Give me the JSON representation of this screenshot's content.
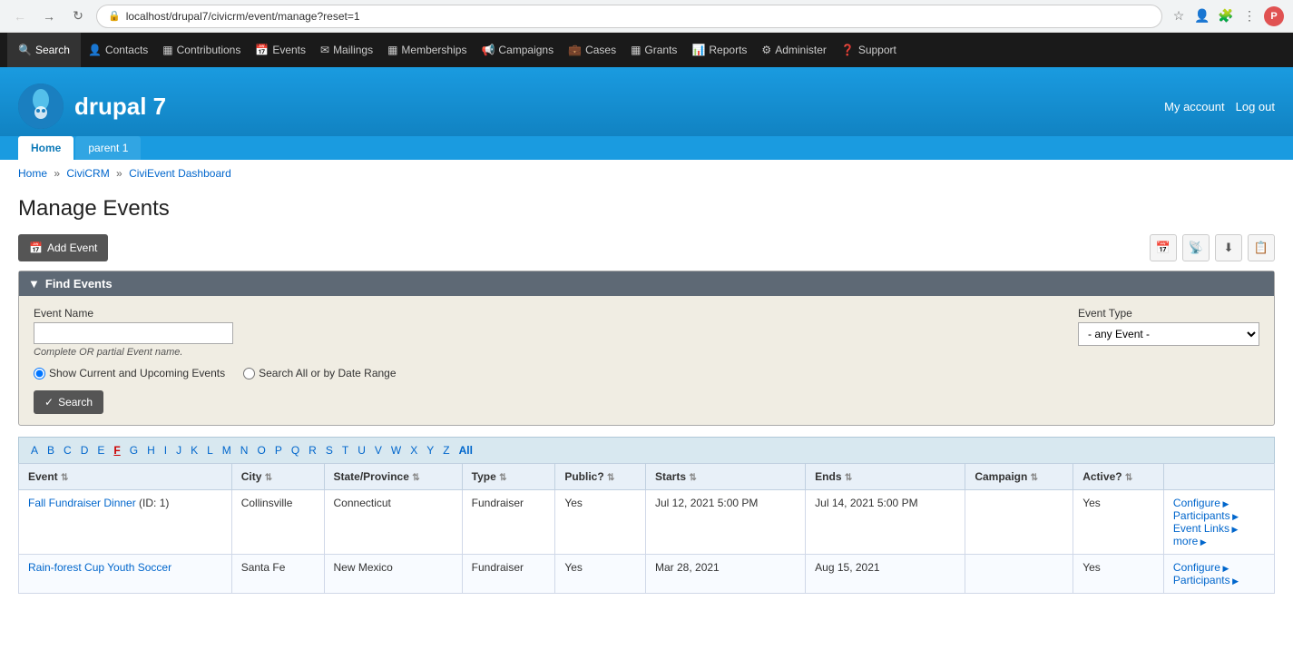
{
  "browser": {
    "url": "localhost/drupal7/civicrm/event/manage?reset=1",
    "avatar_label": "P"
  },
  "top_nav": {
    "search_label": "Search",
    "items": [
      {
        "label": "Contacts",
        "icon": "👤"
      },
      {
        "label": "Contributions",
        "icon": "💰"
      },
      {
        "label": "Events",
        "icon": "📅"
      },
      {
        "label": "Mailings",
        "icon": "✉"
      },
      {
        "label": "Memberships",
        "icon": "🪪"
      },
      {
        "label": "Campaigns",
        "icon": "📢"
      },
      {
        "label": "Cases",
        "icon": "💼"
      },
      {
        "label": "Grants",
        "icon": "📊"
      },
      {
        "label": "Reports",
        "icon": "📈"
      },
      {
        "label": "Administer",
        "icon": "⚙"
      },
      {
        "label": "Support",
        "icon": "❓"
      }
    ]
  },
  "site": {
    "name": "drupal 7",
    "my_account": "My account",
    "log_out": "Log out"
  },
  "site_nav": {
    "tabs": [
      {
        "label": "Home",
        "active": true
      },
      {
        "label": "parent 1",
        "active": false
      }
    ]
  },
  "breadcrumb": {
    "items": [
      "Home",
      "CiviCRM",
      "CiviEvent Dashboard"
    ]
  },
  "page": {
    "title": "Manage Events",
    "add_event_label": "Add Event"
  },
  "find_events": {
    "header": "Find Events",
    "event_name_label": "Event Name",
    "event_name_placeholder": "",
    "event_name_hint": "Complete OR partial Event name.",
    "event_type_label": "Event Type",
    "event_type_placeholder": "- any Event -",
    "radio_current": "Show Current and Upcoming Events",
    "radio_all": "Search All or by Date Range",
    "search_label": "Search"
  },
  "alpha_filter": {
    "letters": [
      "A",
      "B",
      "C",
      "D",
      "E",
      "F",
      "G",
      "H",
      "I",
      "J",
      "K",
      "L",
      "M",
      "N",
      "O",
      "P",
      "Q",
      "R",
      "S",
      "T",
      "U",
      "V",
      "W",
      "X",
      "Y",
      "Z"
    ],
    "active": "F",
    "all_label": "All"
  },
  "table": {
    "columns": [
      {
        "label": "Event",
        "sort": true
      },
      {
        "label": "City",
        "sort": true
      },
      {
        "label": "State/Province",
        "sort": true
      },
      {
        "label": "Type",
        "sort": true
      },
      {
        "label": "Public?",
        "sort": true
      },
      {
        "label": "Starts",
        "sort": true
      },
      {
        "label": "Ends",
        "sort": true
      },
      {
        "label": "Campaign",
        "sort": true
      },
      {
        "label": "Active?",
        "sort": true
      },
      {
        "label": "",
        "sort": false
      }
    ],
    "rows": [
      {
        "event": "Fall Fundraiser Dinner",
        "event_id": "ID: 1",
        "city": "Collinsville",
        "state": "Connecticut",
        "type": "Fundraiser",
        "public": "Yes",
        "starts": "Jul 12, 2021 5:00 PM",
        "ends": "Jul 14, 2021 5:00 PM",
        "campaign": "",
        "active": "Yes",
        "actions": [
          "Configure",
          "Participants",
          "Event Links",
          "more"
        ]
      },
      {
        "event": "Rain-forest Cup Youth Soccer",
        "event_id": "",
        "city": "Santa Fe",
        "state": "New Mexico",
        "type": "Fundraiser",
        "public": "Yes",
        "starts": "Mar 28, 2021",
        "ends": "Aug 15, 2021",
        "campaign": "",
        "active": "Yes",
        "actions": [
          "Configure",
          "Participants"
        ]
      }
    ]
  }
}
